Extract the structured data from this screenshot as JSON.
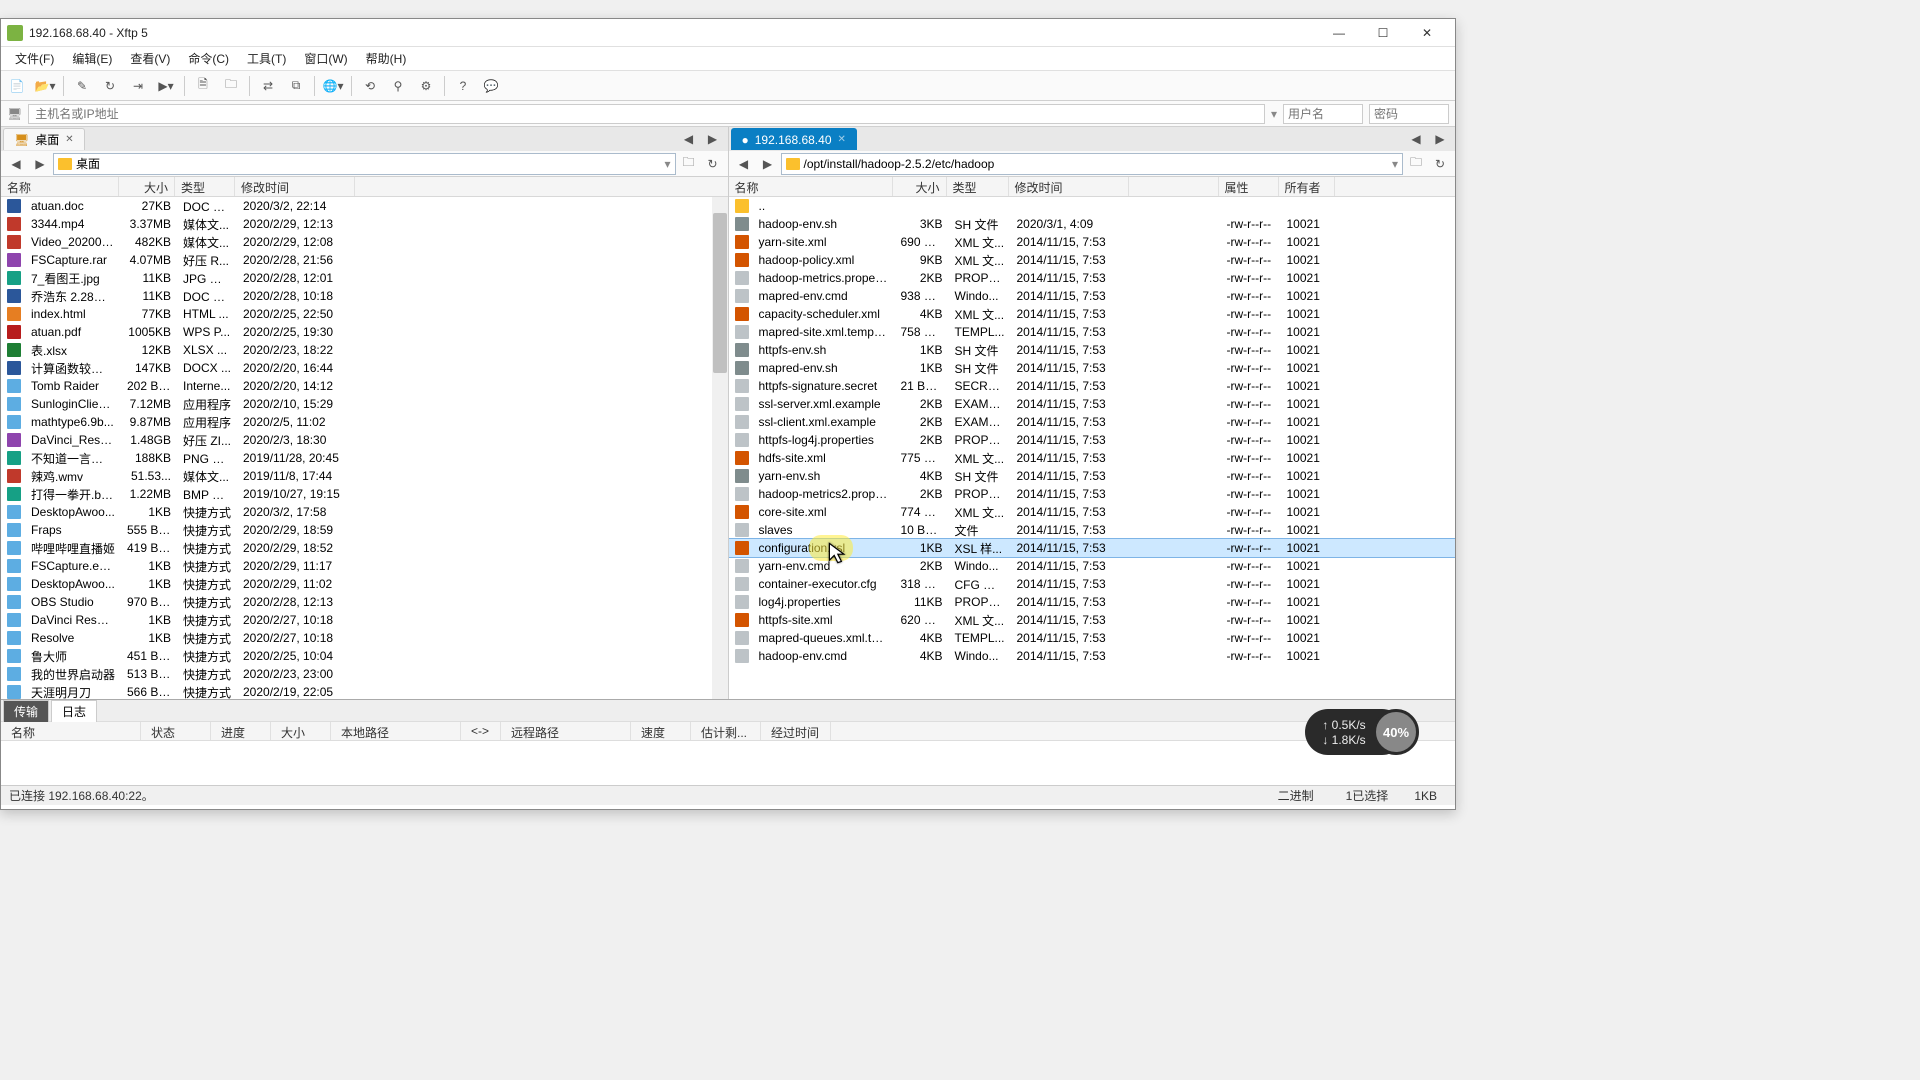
{
  "window": {
    "title": "192.168.68.40   - Xftp 5"
  },
  "menu": [
    "文件(F)",
    "编辑(E)",
    "查看(V)",
    "命令(C)",
    "工具(T)",
    "窗口(W)",
    "帮助(H)"
  ],
  "address": {
    "placeholder": "主机名或IP地址",
    "user_ph": "用户名",
    "pass_ph": "密码"
  },
  "local": {
    "tab": "桌面",
    "path": "桌面",
    "cols": [
      "名称",
      "大小",
      "类型",
      "修改时间"
    ],
    "files": [
      {
        "ic": "doc",
        "name": "atuan.doc",
        "size": "27KB",
        "type": "DOC 文...",
        "date": "2020/3/2, 22:14"
      },
      {
        "ic": "media",
        "name": "3344.mp4",
        "size": "3.37MB",
        "type": "媒体文...",
        "date": "2020/2/29, 12:13"
      },
      {
        "ic": "media",
        "name": "Video_202002...",
        "size": "482KB",
        "type": "媒体文...",
        "date": "2020/2/29, 12:08"
      },
      {
        "ic": "zip",
        "name": "FSCapture.rar",
        "size": "4.07MB",
        "type": "好压 R...",
        "date": "2020/2/28, 21:56"
      },
      {
        "ic": "img",
        "name": "7_看图王.jpg",
        "size": "11KB",
        "type": "JPG 文件",
        "date": "2020/2/28, 12:01"
      },
      {
        "ic": "doc",
        "name": "乔浩东 2.28周...",
        "size": "11KB",
        "type": "DOC 文...",
        "date": "2020/2/28, 10:18"
      },
      {
        "ic": "html",
        "name": "index.html",
        "size": "77KB",
        "type": "HTML ...",
        "date": "2020/2/25, 22:50"
      },
      {
        "ic": "pdf",
        "name": "atuan.pdf",
        "size": "1005KB",
        "type": "WPS P...",
        "date": "2020/2/25, 19:30"
      },
      {
        "ic": "xls",
        "name": "表.xlsx",
        "size": "12KB",
        "type": "XLSX ...",
        "date": "2020/2/23, 18:22"
      },
      {
        "ic": "doc",
        "name": "计算函数较限的...",
        "size": "147KB",
        "type": "DOCX ...",
        "date": "2020/2/20, 16:44"
      },
      {
        "ic": "lnk",
        "name": "Tomb Raider",
        "size": "202 By...",
        "type": "Interne...",
        "date": "2020/2/20, 14:12"
      },
      {
        "ic": "lnk",
        "name": "SunloginClient...",
        "size": "7.12MB",
        "type": "应用程序",
        "date": "2020/2/10, 15:29"
      },
      {
        "ic": "lnk",
        "name": "mathtype6.9b...",
        "size": "9.87MB",
        "type": "应用程序",
        "date": "2020/2/5, 11:02"
      },
      {
        "ic": "zip",
        "name": "DaVinci_Resol...",
        "size": "1.48GB",
        "type": "好压 ZI...",
        "date": "2020/2/3, 18:30"
      },
      {
        "ic": "img",
        "name": "不知道一言以赴...",
        "size": "188KB",
        "type": "PNG 文件",
        "date": "2019/11/28, 20:45"
      },
      {
        "ic": "media",
        "name": "辣鸡.wmv",
        "size": "51.53...",
        "type": "媒体文...",
        "date": "2019/11/8, 17:44"
      },
      {
        "ic": "img",
        "name": "打得一拳开.bmp",
        "size": "1.22MB",
        "type": "BMP 文件",
        "date": "2019/10/27, 19:15"
      },
      {
        "ic": "lnk",
        "name": "DesktopAwoo...",
        "size": "1KB",
        "type": "快捷方式",
        "date": "2020/3/2, 17:58"
      },
      {
        "ic": "lnk",
        "name": "Fraps",
        "size": "555 By...",
        "type": "快捷方式",
        "date": "2020/2/29, 18:59"
      },
      {
        "ic": "lnk",
        "name": "哔哩哔哩直播姬",
        "size": "419 By...",
        "type": "快捷方式",
        "date": "2020/2/29, 18:52"
      },
      {
        "ic": "lnk",
        "name": "FSCapture.exe...",
        "size": "1KB",
        "type": "快捷方式",
        "date": "2020/2/29, 11:17"
      },
      {
        "ic": "lnk",
        "name": "DesktopAwoo...",
        "size": "1KB",
        "type": "快捷方式",
        "date": "2020/2/29, 11:02"
      },
      {
        "ic": "lnk",
        "name": "OBS Studio",
        "size": "970 By...",
        "type": "快捷方式",
        "date": "2020/2/28, 12:13"
      },
      {
        "ic": "lnk",
        "name": "DaVinci Resolv...",
        "size": "1KB",
        "type": "快捷方式",
        "date": "2020/2/27, 10:18"
      },
      {
        "ic": "lnk",
        "name": "Resolve",
        "size": "1KB",
        "type": "快捷方式",
        "date": "2020/2/27, 10:18"
      },
      {
        "ic": "lnk",
        "name": "鲁大师",
        "size": "451 By...",
        "type": "快捷方式",
        "date": "2020/2/25, 10:04"
      },
      {
        "ic": "lnk",
        "name": "我的世界启动器",
        "size": "513 By...",
        "type": "快捷方式",
        "date": "2020/2/23, 23:00"
      },
      {
        "ic": "lnk",
        "name": "天涯明月刀",
        "size": "566 By...",
        "type": "快捷方式",
        "date": "2020/2/19, 22:05"
      }
    ]
  },
  "remote": {
    "tab": "192.168.68.40",
    "path": "/opt/install/hadoop-2.5.2/etc/hadoop",
    "cols": [
      "名称",
      "大小",
      "类型",
      "修改时间",
      "属性",
      "所有者"
    ],
    "selected": 19,
    "files": [
      {
        "ic": "fld",
        "name": "..",
        "size": "",
        "type": "",
        "date": "",
        "attr": "",
        "own": ""
      },
      {
        "ic": "sh",
        "name": "hadoop-env.sh",
        "size": "3KB",
        "type": "SH 文件",
        "date": "2020/3/1, 4:09",
        "attr": "-rw-r--r--",
        "own": "10021"
      },
      {
        "ic": "xml",
        "name": "yarn-site.xml",
        "size": "690 By...",
        "type": "XML 文...",
        "date": "2014/11/15, 7:53",
        "attr": "-rw-r--r--",
        "own": "10021"
      },
      {
        "ic": "xml",
        "name": "hadoop-policy.xml",
        "size": "9KB",
        "type": "XML 文...",
        "date": "2014/11/15, 7:53",
        "attr": "-rw-r--r--",
        "own": "10021"
      },
      {
        "ic": "txt",
        "name": "hadoop-metrics.propert...",
        "size": "2KB",
        "type": "PROPE...",
        "date": "2014/11/15, 7:53",
        "attr": "-rw-r--r--",
        "own": "10021"
      },
      {
        "ic": "txt",
        "name": "mapred-env.cmd",
        "size": "938 By...",
        "type": "Windo...",
        "date": "2014/11/15, 7:53",
        "attr": "-rw-r--r--",
        "own": "10021"
      },
      {
        "ic": "xml",
        "name": "capacity-scheduler.xml",
        "size": "4KB",
        "type": "XML 文...",
        "date": "2014/11/15, 7:53",
        "attr": "-rw-r--r--",
        "own": "10021"
      },
      {
        "ic": "txt",
        "name": "mapred-site.xml.template",
        "size": "758 By...",
        "type": "TEMPL...",
        "date": "2014/11/15, 7:53",
        "attr": "-rw-r--r--",
        "own": "10021"
      },
      {
        "ic": "sh",
        "name": "httpfs-env.sh",
        "size": "1KB",
        "type": "SH 文件",
        "date": "2014/11/15, 7:53",
        "attr": "-rw-r--r--",
        "own": "10021"
      },
      {
        "ic": "sh",
        "name": "mapred-env.sh",
        "size": "1KB",
        "type": "SH 文件",
        "date": "2014/11/15, 7:53",
        "attr": "-rw-r--r--",
        "own": "10021"
      },
      {
        "ic": "txt",
        "name": "httpfs-signature.secret",
        "size": "21 Bytes",
        "type": "SECRET...",
        "date": "2014/11/15, 7:53",
        "attr": "-rw-r--r--",
        "own": "10021"
      },
      {
        "ic": "txt",
        "name": "ssl-server.xml.example",
        "size": "2KB",
        "type": "EXAMP...",
        "date": "2014/11/15, 7:53",
        "attr": "-rw-r--r--",
        "own": "10021"
      },
      {
        "ic": "txt",
        "name": "ssl-client.xml.example",
        "size": "2KB",
        "type": "EXAMP...",
        "date": "2014/11/15, 7:53",
        "attr": "-rw-r--r--",
        "own": "10021"
      },
      {
        "ic": "txt",
        "name": "httpfs-log4j.properties",
        "size": "2KB",
        "type": "PROPE...",
        "date": "2014/11/15, 7:53",
        "attr": "-rw-r--r--",
        "own": "10021"
      },
      {
        "ic": "xml",
        "name": "hdfs-site.xml",
        "size": "775 By...",
        "type": "XML 文...",
        "date": "2014/11/15, 7:53",
        "attr": "-rw-r--r--",
        "own": "10021"
      },
      {
        "ic": "sh",
        "name": "yarn-env.sh",
        "size": "4KB",
        "type": "SH 文件",
        "date": "2014/11/15, 7:53",
        "attr": "-rw-r--r--",
        "own": "10021"
      },
      {
        "ic": "txt",
        "name": "hadoop-metrics2.prope...",
        "size": "2KB",
        "type": "PROPE...",
        "date": "2014/11/15, 7:53",
        "attr": "-rw-r--r--",
        "own": "10021"
      },
      {
        "ic": "xml",
        "name": "core-site.xml",
        "size": "774 By...",
        "type": "XML 文...",
        "date": "2014/11/15, 7:53",
        "attr": "-rw-r--r--",
        "own": "10021"
      },
      {
        "ic": "txt",
        "name": "slaves",
        "size": "10 Bytes",
        "type": "文件",
        "date": "2014/11/15, 7:53",
        "attr": "-rw-r--r--",
        "own": "10021"
      },
      {
        "ic": "xml",
        "name": "configuration.xsl",
        "size": "1KB",
        "type": "XSL 样...",
        "date": "2014/11/15, 7:53",
        "attr": "-rw-r--r--",
        "own": "10021"
      },
      {
        "ic": "txt",
        "name": "yarn-env.cmd",
        "size": "2KB",
        "type": "Windo...",
        "date": "2014/11/15, 7:53",
        "attr": "-rw-r--r--",
        "own": "10021"
      },
      {
        "ic": "txt",
        "name": "container-executor.cfg",
        "size": "318 By...",
        "type": "CFG 文件",
        "date": "2014/11/15, 7:53",
        "attr": "-rw-r--r--",
        "own": "10021"
      },
      {
        "ic": "txt",
        "name": "log4j.properties",
        "size": "11KB",
        "type": "PROPE...",
        "date": "2014/11/15, 7:53",
        "attr": "-rw-r--r--",
        "own": "10021"
      },
      {
        "ic": "xml",
        "name": "httpfs-site.xml",
        "size": "620 By...",
        "type": "XML 文...",
        "date": "2014/11/15, 7:53",
        "attr": "-rw-r--r--",
        "own": "10021"
      },
      {
        "ic": "txt",
        "name": "mapred-queues.xml.tem...",
        "size": "4KB",
        "type": "TEMPL...",
        "date": "2014/11/15, 7:53",
        "attr": "-rw-r--r--",
        "own": "10021"
      },
      {
        "ic": "txt",
        "name": "hadoop-env.cmd",
        "size": "4KB",
        "type": "Windo...",
        "date": "2014/11/15, 7:53",
        "attr": "-rw-r--r--",
        "own": "10021"
      }
    ]
  },
  "xfer": {
    "tabs": [
      "传输",
      "日志"
    ],
    "cols": [
      "名称",
      "状态",
      "进度",
      "大小",
      "本地路径",
      "<->",
      "远程路径",
      "速度",
      "估计剩...",
      "经过时间"
    ]
  },
  "status": {
    "left": "已连接 192.168.68.40:22。",
    "r1": "二进制",
    "r2": "1已选择",
    "r3": "1KB"
  },
  "speed": {
    "up": "↑ 0.5K/s",
    "down": "↓ 1.8K/s",
    "pct": "40%"
  }
}
